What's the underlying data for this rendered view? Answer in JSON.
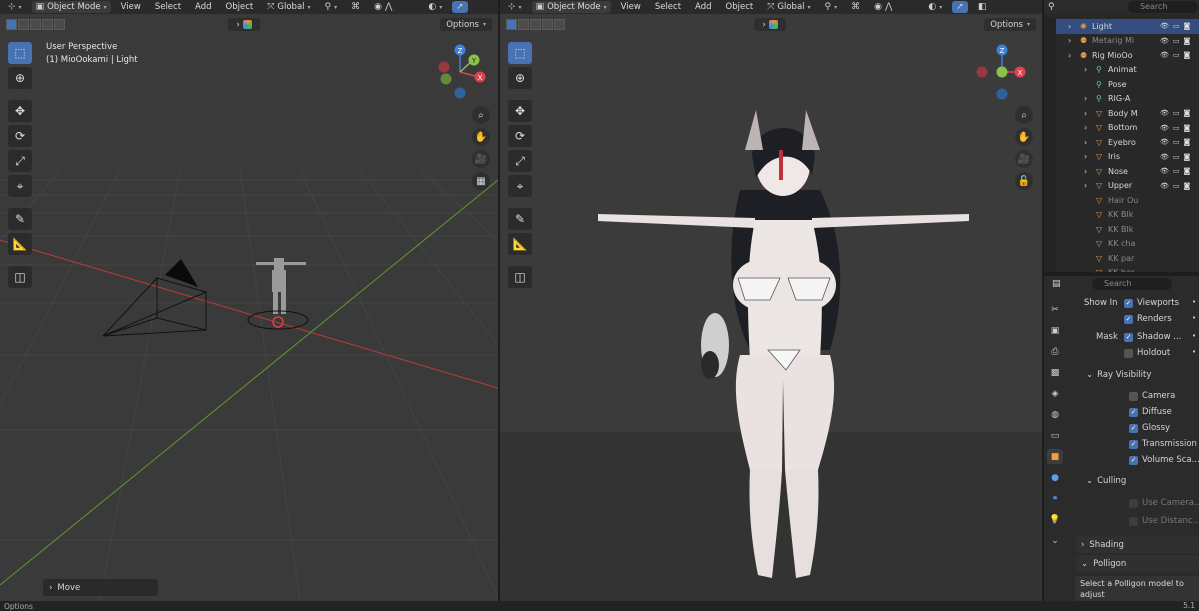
{
  "left_viewport": {
    "mode": "Object Mode",
    "menus": [
      "View",
      "Select",
      "Add",
      "Object"
    ],
    "orientation": "Global",
    "options_label": "Options",
    "view_label": "User Perspective",
    "context_label": "(1) MioOokami | Light",
    "last_op": "Move"
  },
  "right_viewport": {
    "mode": "Object Mode",
    "menus": [
      "View",
      "Select",
      "Add",
      "Object"
    ],
    "orientation": "Global",
    "options_label": "Options"
  },
  "gizmo": {
    "z": "Z",
    "y": "Y",
    "x": "X"
  },
  "outliner": {
    "search_placeholder": "Search",
    "rows": [
      {
        "name": "Light",
        "dim": false
      },
      {
        "name": "Metarig Mi",
        "dim": true
      },
      {
        "name": "Rig MioOo",
        "dim": false
      },
      {
        "name": "Animat",
        "dim": false
      },
      {
        "name": "Pose",
        "dim": false
      },
      {
        "name": "RIG-A",
        "dim": false
      },
      {
        "name": "Body M",
        "dim": false
      },
      {
        "name": "Bottom",
        "dim": false
      },
      {
        "name": "Eyebro",
        "dim": false
      },
      {
        "name": "Iris",
        "dim": false
      },
      {
        "name": "Nose",
        "dim": false
      },
      {
        "name": "Upper",
        "dim": false
      },
      {
        "name": "Hair Ou",
        "dim": true
      },
      {
        "name": "KK Blk",
        "dim": true
      },
      {
        "name": "KK Blk",
        "dim": true
      },
      {
        "name": "KK cha",
        "dim": true
      },
      {
        "name": "KK par",
        "dim": true
      },
      {
        "name": "KK bar",
        "dim": true
      }
    ]
  },
  "properties": {
    "search_placeholder": "Search",
    "show_in_label": "Show In",
    "viewports_label": "Viewports",
    "renders_label": "Renders",
    "mask_label": "Mask",
    "shadow_label": "Shadow ...",
    "holdout_label": "Holdout",
    "ray_visibility_label": "Ray Visibility",
    "camera_label": "Camera",
    "diffuse_label": "Diffuse",
    "glossy_label": "Glossy",
    "transmission_label": "Transmission",
    "volume_label": "Volume Sca...",
    "culling_label": "Culling",
    "use_camera_label": "Use Camera...",
    "use_distance_label": "Use Distanc...",
    "shading_label": "Shading",
    "polygon_label": "Polligon",
    "tip_text": "Select a Polligon model to adjust"
  },
  "status": {
    "left": "Options",
    "right": "5.1"
  },
  "colors": {
    "accent": "#4772b3",
    "x_axis": "#e0424d",
    "y_axis": "#8bc34a",
    "z_axis": "#3b82d9"
  }
}
